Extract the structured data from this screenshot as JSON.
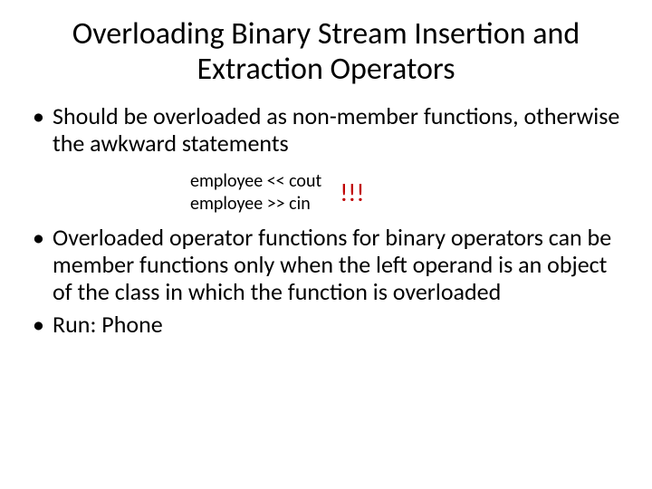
{
  "title": "Overloading Binary Stream Insertion and Extraction Operators",
  "bullet1": "Should be overloaded as non-member functions, otherwise the awkward statements",
  "code": {
    "line1": "employee << cout",
    "line2": "employee >> cin",
    "exclaim": "!!!"
  },
  "bullet2": "Overloaded operator functions for binary operators can be member functions only when the left operand is an object of the class in which the function is overloaded",
  "bullet3": "Run: Phone"
}
